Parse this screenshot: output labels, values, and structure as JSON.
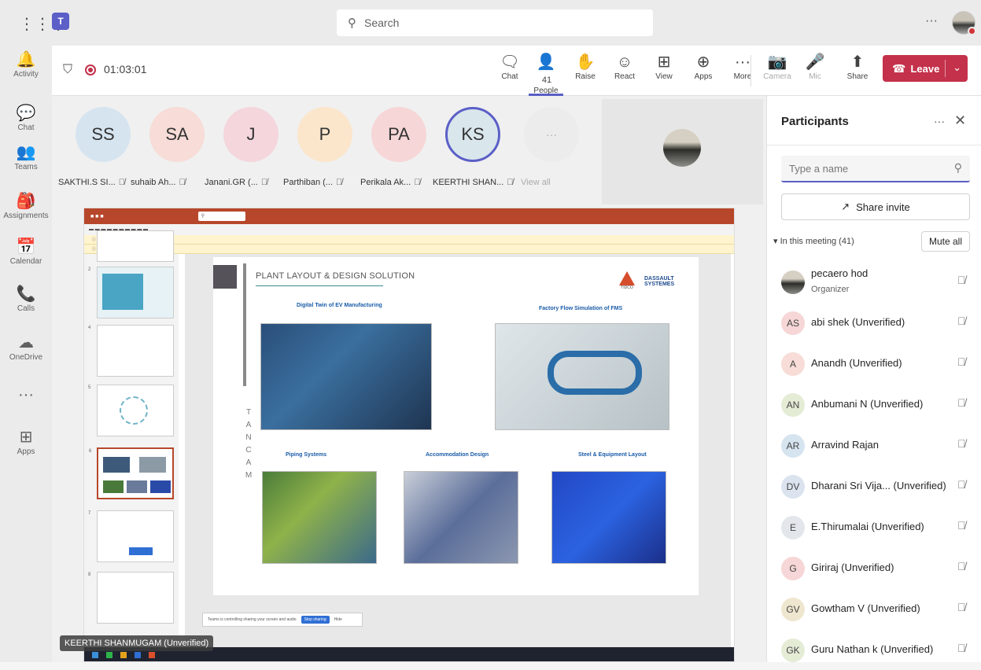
{
  "topbar": {
    "search_placeholder": "Search",
    "more": "···"
  },
  "rail": [
    {
      "icon": "bell-icon",
      "label": "Activity",
      "glyph": "🔔"
    },
    {
      "icon": "chat-icon",
      "label": "Chat",
      "glyph": "💬"
    },
    {
      "icon": "teams-icon",
      "label": "Teams",
      "glyph": "👥"
    },
    {
      "icon": "assignments-icon",
      "label": "Assignments",
      "glyph": "🎒"
    },
    {
      "icon": "calendar-icon",
      "label": "Calendar",
      "glyph": "📅"
    },
    {
      "icon": "phone-icon",
      "label": "Calls",
      "glyph": "📞"
    },
    {
      "icon": "cloud-icon",
      "label": "OneDrive",
      "glyph": "☁"
    },
    {
      "icon": "more-icon",
      "label": "",
      "glyph": "···"
    },
    {
      "icon": "apps-icon",
      "label": "Apps",
      "glyph": "⊞"
    }
  ],
  "call": {
    "timer": "01:03:01",
    "people_count": "41",
    "buttons": [
      {
        "name": "chat",
        "label": "Chat",
        "glyph": "🗨"
      },
      {
        "name": "people",
        "label": "People",
        "glyph": "👤"
      },
      {
        "name": "raise",
        "label": "Raise",
        "glyph": "✋"
      },
      {
        "name": "react",
        "label": "React",
        "glyph": "☺"
      },
      {
        "name": "view",
        "label": "View",
        "glyph": "⊞"
      },
      {
        "name": "apps",
        "label": "Apps",
        "glyph": "⊕"
      },
      {
        "name": "more",
        "label": "More",
        "glyph": "···"
      },
      {
        "name": "camera",
        "label": "Camera",
        "glyph": "📷"
      },
      {
        "name": "mic",
        "label": "Mic",
        "glyph": "🎤"
      },
      {
        "name": "share",
        "label": "Share",
        "glyph": "⬆"
      }
    ],
    "leave": "Leave"
  },
  "avatars": [
    {
      "initials": "SS",
      "name": "SAKTHI.S SI...",
      "color": "#d6e4f0"
    },
    {
      "initials": "SA",
      "name": "suhaib Ah...",
      "color": "#f7dcd7"
    },
    {
      "initials": "J",
      "name": "Janani.GR (...",
      "color": "#f4d6dc"
    },
    {
      "initials": "P",
      "name": "Parthiban (...",
      "color": "#fbe6cc"
    },
    {
      "initials": "PA",
      "name": "Perikala Ak...",
      "color": "#f6d6d6"
    },
    {
      "initials": "KS",
      "name": "KEERTHI SHAN...",
      "color": "#d9e6ec"
    },
    {
      "initials": "···",
      "name": "View all",
      "color": "#ececec"
    }
  ],
  "slide": {
    "title": "PLANT LAYOUT & DESIGN SOLUTION",
    "vertical_text": [
      "T",
      "A",
      "N",
      "C",
      "A",
      "M"
    ],
    "logo_tidco": "TIDCO",
    "logo_ds": "DASSAULT SYSTEMES",
    "captions": [
      "Digital Twin of EV Manufacturing",
      "Factory Flow Simulation of FMS",
      "Piping Systems",
      "Accommodation Design",
      "Steel & Equipment Layout"
    ]
  },
  "share_bar": {
    "text": "Teams is controlling sharing your screen and audio",
    "stop": "Stop sharing",
    "hide": "Hide"
  },
  "name_tag": "KEERTHI SHANMUGAM (Unverified)",
  "panel": {
    "title": "Participants",
    "search_placeholder": "Type a name",
    "share_invite": "Share invite",
    "in_meeting": "In this meeting (41)",
    "mute_all": "Mute all",
    "people": [
      {
        "initials": "",
        "name": "pecaero hod",
        "role": "Organizer",
        "color": ""
      },
      {
        "initials": "AS",
        "name": "abi shek (Unverified)",
        "role": "",
        "color": "#f6d6d6"
      },
      {
        "initials": "A",
        "name": "Anandh (Unverified)",
        "role": "",
        "color": "#f7dcd7"
      },
      {
        "initials": "AN",
        "name": "Anbumani N (Unverified)",
        "role": "",
        "color": "#e4ecd6"
      },
      {
        "initials": "AR",
        "name": "Arravind Rajan",
        "role": "",
        "color": "#d6e4f0"
      },
      {
        "initials": "DV",
        "name": "Dharani Sri Vija... (Unverified)",
        "role": "",
        "color": "#dbe3ee"
      },
      {
        "initials": "E",
        "name": "E.Thirumalai (Unverified)",
        "role": "",
        "color": "#e3e6ea"
      },
      {
        "initials": "G",
        "name": "Giriraj (Unverified)",
        "role": "",
        "color": "#f6d6d6"
      },
      {
        "initials": "GV",
        "name": "Gowtham V (Unverified)",
        "role": "",
        "color": "#efe6cf"
      },
      {
        "initials": "GK",
        "name": "Guru Nathan k (Unverified)",
        "role": "",
        "color": "#e4ecd6"
      }
    ]
  }
}
